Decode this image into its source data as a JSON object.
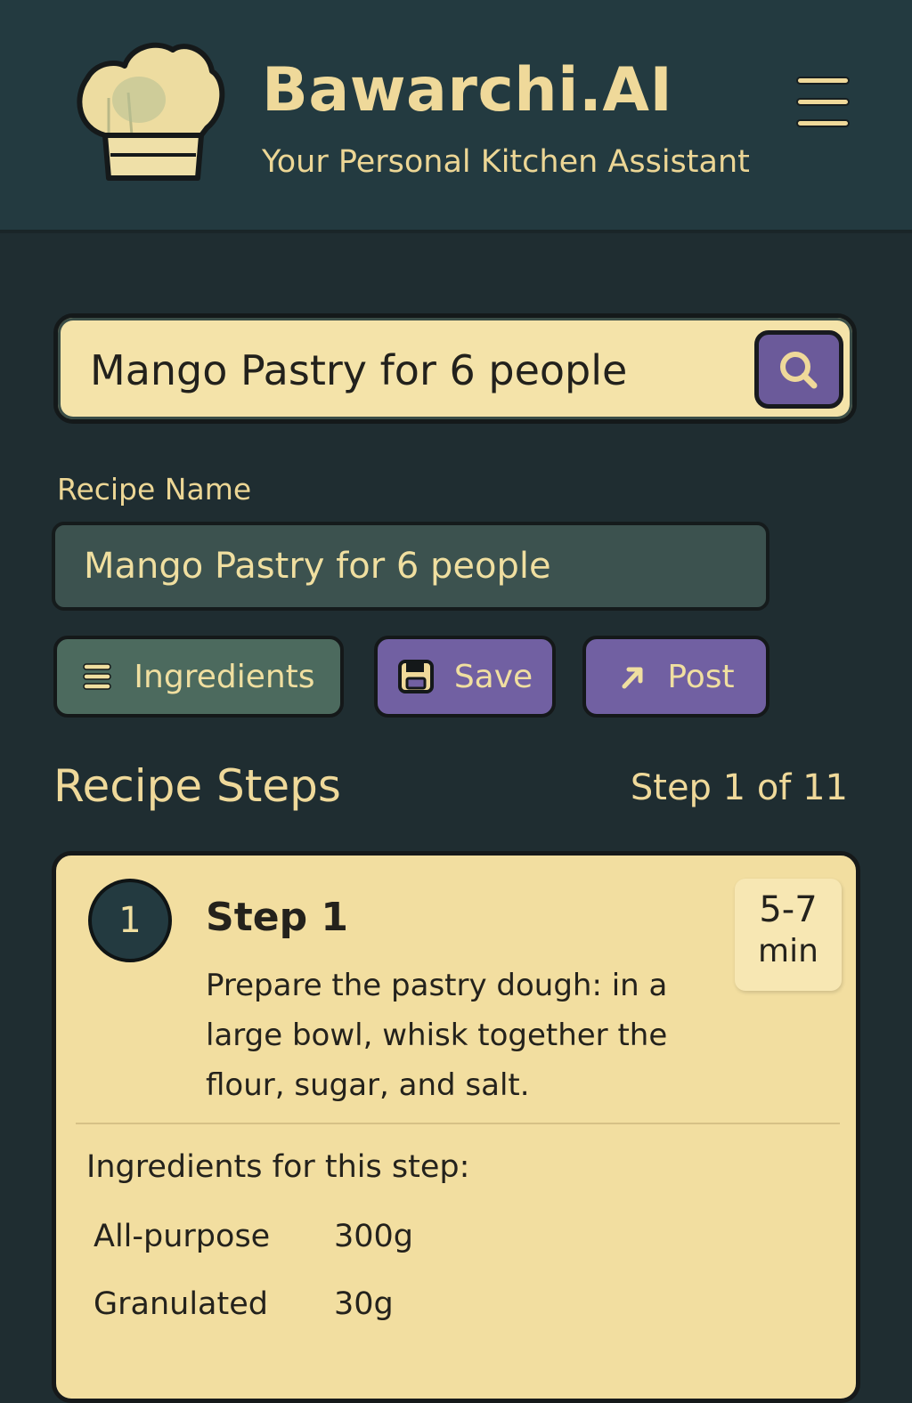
{
  "header": {
    "title": "Bawarchi.AI",
    "subtitle": "Your Personal Kitchen Assistant",
    "logo_icon": "chef-hat-icon",
    "menu_icon": "hamburger-menu-icon"
  },
  "search": {
    "value": "Mango Pastry for 6 people",
    "icon": "search-icon"
  },
  "recipe": {
    "label": "Recipe Name",
    "name": "Mango Pastry for 6 people"
  },
  "actions": {
    "ingredients_label": "Ingredients",
    "ingredients_icon": "list-icon",
    "save_label": "Save",
    "save_icon": "floppy-disk-icon",
    "post_label": "Post",
    "post_icon": "arrow-up-right-icon"
  },
  "steps": {
    "heading": "Recipe Steps",
    "counter": "Step 1 of 11",
    "current": {
      "number": "1",
      "title": "Step 1",
      "time_value": "5-7",
      "time_unit": "min",
      "description": "Prepare the pastry dough: in a large bowl, whisk together the flour, sugar, and salt.",
      "ingredients_heading": "Ingredients for this step:",
      "ingredients": [
        {
          "name": "All-purpose",
          "qty": "300g"
        },
        {
          "name": "Granulated",
          "qty": "30g"
        }
      ]
    }
  },
  "colors": {
    "background": "#1f2d31",
    "header": "#233a40",
    "cream": "#f2dea0",
    "accent_purple": "#7160a2",
    "accent_green": "#4c6a5e",
    "text_gold": "#efd99a"
  }
}
